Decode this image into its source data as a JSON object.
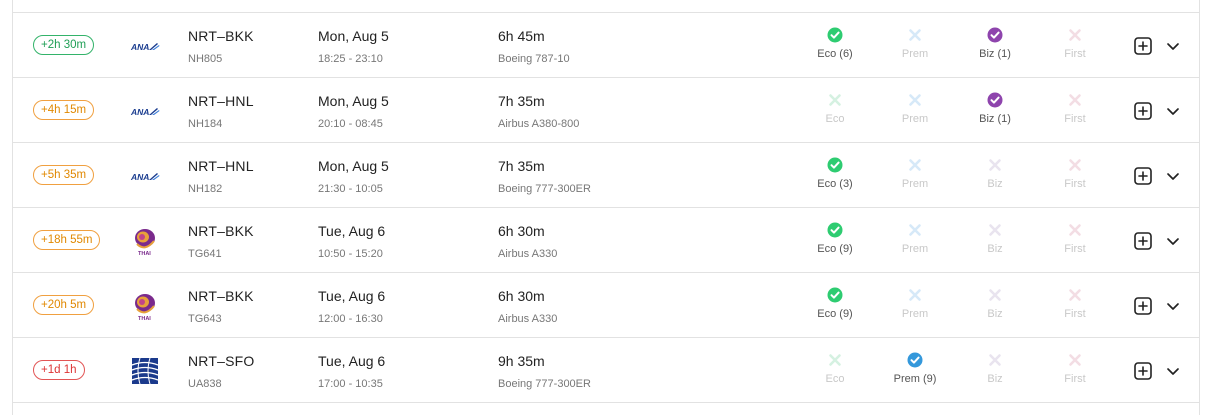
{
  "colors": {
    "available": "#2ecc71",
    "business_available": "#8e44ad",
    "premium_available": "#3498db",
    "unavailable_x_blue": "#d6e9f8",
    "unavailable_x_pink": "#f3dde4",
    "unavailable_x_light": "#e9e4ef"
  },
  "flights": [
    {
      "delta": "+2h 30m",
      "delta_style": "green",
      "airline_logo": "ana-logo-icon",
      "route": "NRT–BKK",
      "flight_no": "NH805",
      "date": "Mon, Aug 5",
      "times": "18:25 - 23:10",
      "duration": "6h 45m",
      "aircraft": "Boeing 787-10",
      "cabins": [
        {
          "label": "Eco (6)",
          "status": "available",
          "icon": "check-green-icon"
        },
        {
          "label": "Prem",
          "status": "unavailable",
          "icon": "x-blue-icon"
        },
        {
          "label": "Biz (1)",
          "status": "available",
          "icon": "check-purple-icon"
        },
        {
          "label": "First",
          "status": "unavailable",
          "icon": "x-pink-icon"
        }
      ]
    },
    {
      "delta": "+4h 15m",
      "delta_style": "orange",
      "airline_logo": "ana-logo-icon",
      "route": "NRT–HNL",
      "flight_no": "NH184",
      "date": "Mon, Aug 5",
      "times": "20:10 - 08:45",
      "duration": "7h 35m",
      "aircraft": "Airbus A380-800",
      "cabins": [
        {
          "label": "Eco",
          "status": "unavailable",
          "icon": "x-green-icon"
        },
        {
          "label": "Prem",
          "status": "unavailable",
          "icon": "x-blue-icon"
        },
        {
          "label": "Biz (1)",
          "status": "available",
          "icon": "check-purple-icon"
        },
        {
          "label": "First",
          "status": "unavailable",
          "icon": "x-pink-icon"
        }
      ]
    },
    {
      "delta": "+5h 35m",
      "delta_style": "orange",
      "airline_logo": "ana-logo-icon",
      "route": "NRT–HNL",
      "flight_no": "NH182",
      "date": "Mon, Aug 5",
      "times": "21:30 - 10:05",
      "duration": "7h 35m",
      "aircraft": "Boeing 777-300ER",
      "cabins": [
        {
          "label": "Eco (3)",
          "status": "available",
          "icon": "check-green-icon"
        },
        {
          "label": "Prem",
          "status": "unavailable",
          "icon": "x-blue-icon"
        },
        {
          "label": "Biz",
          "status": "unavailable",
          "icon": "x-light-icon"
        },
        {
          "label": "First",
          "status": "unavailable",
          "icon": "x-pink-icon"
        }
      ]
    },
    {
      "delta": "+18h 55m",
      "delta_style": "orange",
      "airline_logo": "thai-logo-icon",
      "route": "NRT–BKK",
      "flight_no": "TG641",
      "date": "Tue, Aug 6",
      "times": "10:50 - 15:20",
      "duration": "6h 30m",
      "aircraft": "Airbus A330",
      "cabins": [
        {
          "label": "Eco (9)",
          "status": "available",
          "icon": "check-green-icon"
        },
        {
          "label": "Prem",
          "status": "unavailable",
          "icon": "x-blue-icon"
        },
        {
          "label": "Biz",
          "status": "unavailable",
          "icon": "x-light-icon"
        },
        {
          "label": "First",
          "status": "unavailable",
          "icon": "x-pink-icon"
        }
      ]
    },
    {
      "delta": "+20h 5m",
      "delta_style": "orange",
      "airline_logo": "thai-logo-icon",
      "route": "NRT–BKK",
      "flight_no": "TG643",
      "date": "Tue, Aug 6",
      "times": "12:00 - 16:30",
      "duration": "6h 30m",
      "aircraft": "Airbus A330",
      "cabins": [
        {
          "label": "Eco (9)",
          "status": "available",
          "icon": "check-green-icon"
        },
        {
          "label": "Prem",
          "status": "unavailable",
          "icon": "x-blue-icon"
        },
        {
          "label": "Biz",
          "status": "unavailable",
          "icon": "x-light-icon"
        },
        {
          "label": "First",
          "status": "unavailable",
          "icon": "x-pink-icon"
        }
      ]
    },
    {
      "delta": "+1d 1h",
      "delta_style": "red",
      "airline_logo": "united-logo-icon",
      "route": "NRT–SFO",
      "flight_no": "UA838",
      "date": "Tue, Aug 6",
      "times": "17:00 - 10:35",
      "duration": "9h 35m",
      "aircraft": "Boeing 777-300ER",
      "cabins": [
        {
          "label": "Eco",
          "status": "unavailable",
          "icon": "x-green-icon"
        },
        {
          "label": "Prem (9)",
          "status": "available",
          "icon": "check-blue-icon"
        },
        {
          "label": "Biz",
          "status": "unavailable",
          "icon": "x-light-icon"
        },
        {
          "label": "First",
          "status": "unavailable",
          "icon": "x-pink-icon"
        }
      ]
    }
  ]
}
